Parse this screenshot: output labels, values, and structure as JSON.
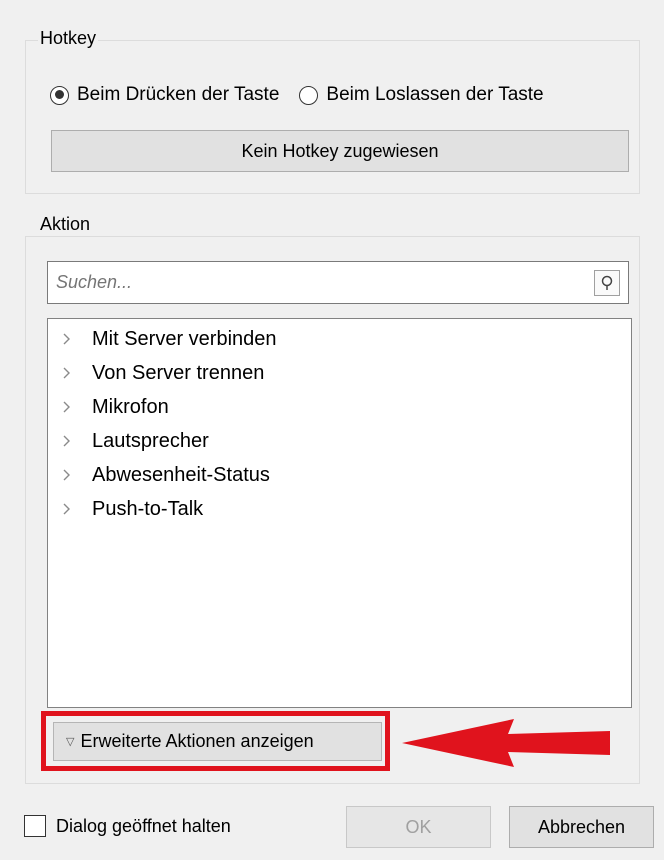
{
  "hotkey": {
    "title": "Hotkey",
    "radio_press": "Beim Drücken der Taste",
    "radio_release": "Beim Loslassen der Taste",
    "selected": "press",
    "assign_button": "Kein Hotkey zugewiesen"
  },
  "action": {
    "title": "Aktion",
    "search_placeholder": "Suchen...",
    "items": [
      {
        "label": "Mit Server verbinden"
      },
      {
        "label": "Von Server trennen"
      },
      {
        "label": "Mikrofon"
      },
      {
        "label": "Lautsprecher"
      },
      {
        "label": "Abwesenheit-Status"
      },
      {
        "label": "Push-to-Talk"
      }
    ],
    "advanced_button": "Erweiterte Aktionen anzeigen"
  },
  "footer": {
    "keep_open_label": "Dialog geöffnet halten",
    "ok_label": "OK",
    "cancel_label": "Abbrechen"
  },
  "colors": {
    "highlight": "#e0131d"
  }
}
